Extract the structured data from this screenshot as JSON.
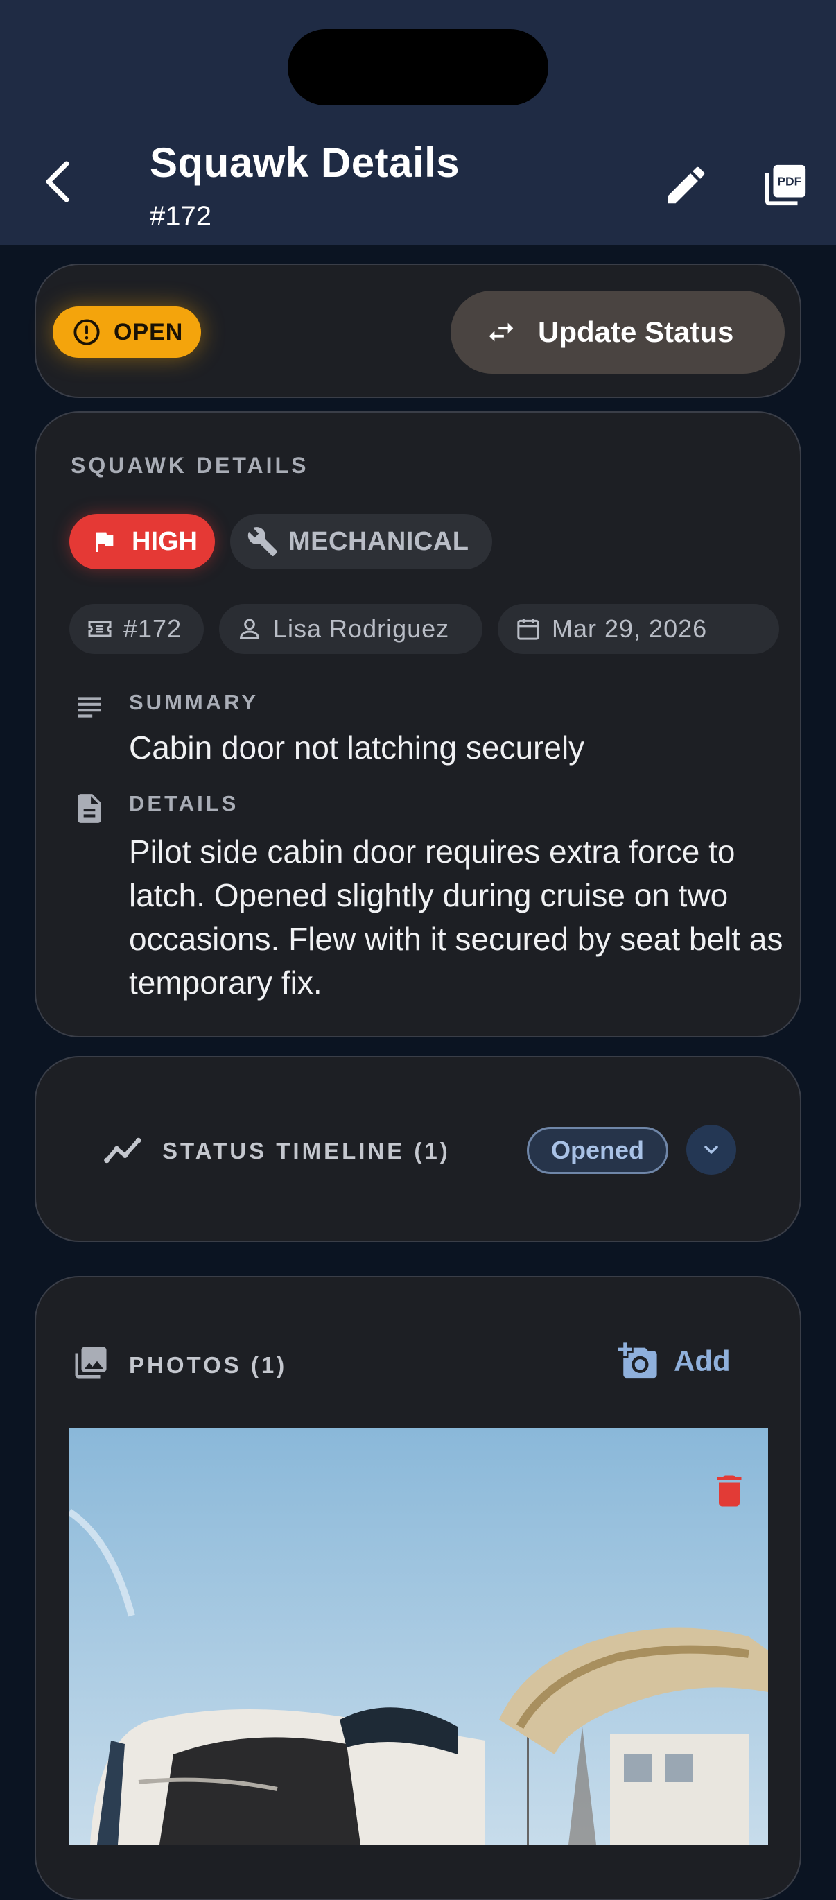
{
  "header": {
    "title": "Squawk Details",
    "subtitle": "#172",
    "back_icon": "chevron-left-icon",
    "edit_icon": "pencil-icon",
    "pdf_icon": "pdf-icon",
    "background": "#1f2b44"
  },
  "status": {
    "badge": "OPEN",
    "badge_color": "#f4a40c",
    "update_button": "Update Status"
  },
  "details": {
    "section_title": "SQUAWK DETAILS",
    "priority": "HIGH",
    "priority_color": "#e53935",
    "category": "MECHANICAL",
    "ticket_number": "#172",
    "reporter": "Lisa Rodriguez",
    "date": "Mar 29, 2026",
    "summary_label": "SUMMARY",
    "summary": "Cabin door not latching securely",
    "details_label": "DETAILS",
    "details_text": "Pilot side cabin door requires extra force to latch. Opened slightly during cruise on two occasions. Flew with it secured by seat belt as temporary fix."
  },
  "timeline": {
    "label": "STATUS TIMELINE (1)",
    "latest": "Opened"
  },
  "photos": {
    "label": "PHOTOS (1)",
    "add_label": "Add",
    "photo_subject": "aircraft cabin door open on ramp"
  }
}
